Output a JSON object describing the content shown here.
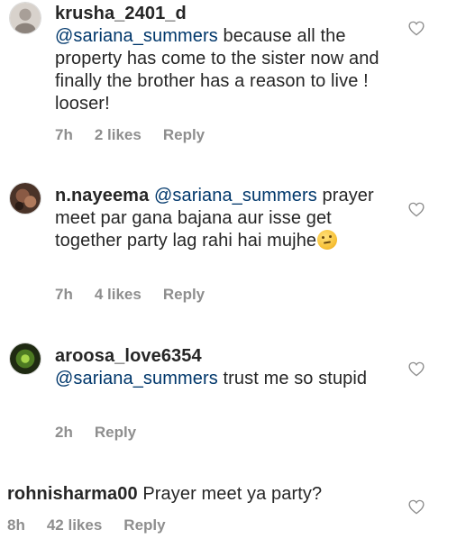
{
  "comments": [
    {
      "username": "krusha_2401_d",
      "mention": "@sariana_summers",
      "text": " because all the property has come to the sister now and finally the brother has a reason to live ! looser!",
      "time": "7h",
      "likes": "2 likes",
      "reply": "Reply",
      "avatar_color": "#c9c2bd"
    },
    {
      "username": "n.nayeema",
      "mention": "@sariana_summers",
      "text": " prayer meet par gana bajana aur isse get together party lag rahi hai mujhe",
      "emoji": "thinking-face-emoji",
      "time": "7h",
      "likes": "4 likes",
      "reply": "Reply",
      "avatar_color": "#6b4a3a"
    },
    {
      "username": "aroosa_love6354",
      "mention": "@sariana_summers",
      "text": " trust me so stupid",
      "time": "2h",
      "reply": "Reply",
      "avatar_color": "#2f4a1a"
    },
    {
      "username": "rohnisharma00",
      "text": " Prayer meet ya party?",
      "time": "8h",
      "likes": "42 likes",
      "reply": "Reply"
    }
  ],
  "colors": {
    "text": "#262626",
    "mention": "#00376b",
    "meta": "#8e8e8e",
    "heart_stroke": "#8e8e8e"
  },
  "icons": {
    "like": "heart-outline-icon"
  }
}
